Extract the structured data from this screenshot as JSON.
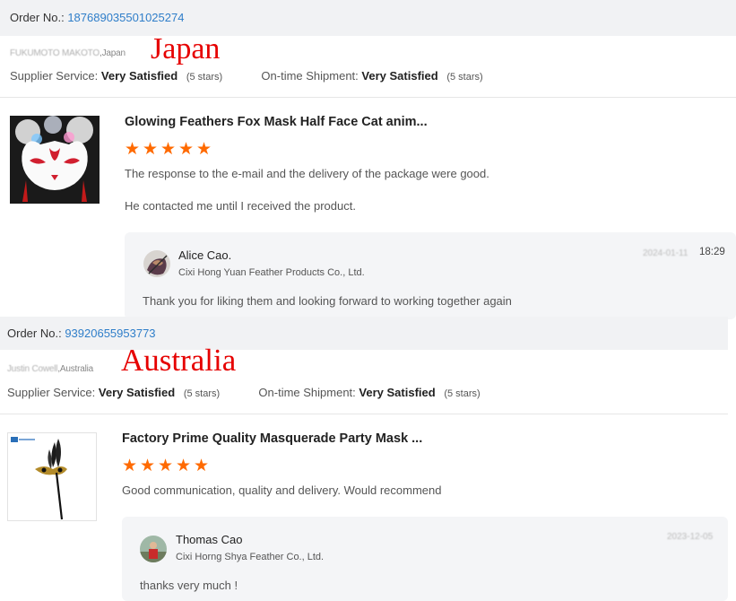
{
  "reviews": [
    {
      "order_label": "Order No.:",
      "order_number": "187689035501025274",
      "buyer_name": "FUKUMOTO MAKOTO",
      "buyer_country": "Japan",
      "overlay_country": "Japan",
      "supplier_service_label": "Supplier Service:",
      "supplier_service_value": "Very Satisfied",
      "supplier_service_stars": "(5 stars)",
      "shipment_label": "On-time Shipment:",
      "shipment_value": "Very Satisfied",
      "shipment_stars": "(5 stars)",
      "product_title": "Glowing Feathers Fox Mask Half Face Cat anim...",
      "rating": 5,
      "review_lines": [
        "The response to the e-mail and the delivery of the package were good.",
        "He contacted me until I received the product."
      ],
      "reply": {
        "name": "Alice Cao.",
        "company": "Cixi Hong Yuan Feather Products Co., Ltd.",
        "text": "Thank you for liking them and looking forward to working together again",
        "date_redacted": "2024-01-11",
        "time": "18:29"
      }
    },
    {
      "order_label": "Order No.:",
      "order_number": "93920655953773",
      "buyer_name": "Justin Cowell",
      "buyer_country": "Australia",
      "overlay_country": "Australia",
      "supplier_service_label": "Supplier Service:",
      "supplier_service_value": "Very Satisfied",
      "supplier_service_stars": "(5 stars)",
      "shipment_label": "On-time Shipment:",
      "shipment_value": "Very Satisfied",
      "shipment_stars": "(5 stars)",
      "product_title": "Factory Prime Quality Masquerade Party Mask ...",
      "rating": 5,
      "review_lines": [
        "Good communication, quality and delivery. Would recommend"
      ],
      "reply": {
        "name": "Thomas Cao",
        "company": "Cixi Horng Shya Feather Co., Ltd.",
        "text": "thanks very much !",
        "date_redacted": "2023-12-05"
      }
    }
  ],
  "colors": {
    "link": "#2f7ec9",
    "star": "#ff6a00",
    "overlay": "#e60000",
    "order_bar": "#f1f2f4",
    "reply_bg": "#f4f5f7"
  },
  "icons": {
    "star": "star-icon"
  }
}
